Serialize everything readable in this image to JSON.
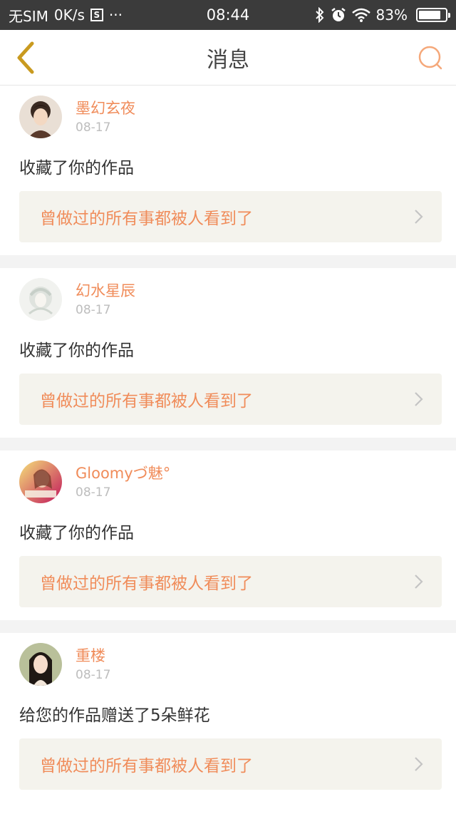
{
  "status_bar": {
    "carrier": "无SIM",
    "speed": "0K/s",
    "sim_glyph": "S",
    "more": "···",
    "time": "08:44",
    "battery_text": "83%",
    "battery_level": 0.83
  },
  "header": {
    "title": "消息"
  },
  "messages": [
    {
      "user": "墨幻玄夜",
      "date": "08-17",
      "action": "收藏了你的作品",
      "work": "曾做过的所有事都被人看到了"
    },
    {
      "user": "幻水星辰",
      "date": "08-17",
      "action": "收藏了你的作品",
      "work": "曾做过的所有事都被人看到了"
    },
    {
      "user": "Gloomyづ魅°",
      "date": "08-17",
      "action": "收藏了你的作品",
      "work": "曾做过的所有事都被人看到了"
    },
    {
      "user": "重楼",
      "date": "08-17",
      "action": "给您的作品赠送了5朵鲜花",
      "work": "曾做过的所有事都被人看到了"
    }
  ],
  "colors": {
    "accent": "#f08c5a",
    "status_bg": "#3b3b3b",
    "back_icon": "#c99a1f",
    "search_icon": "#f5a87a"
  },
  "icons": [
    "back-arrow-icon",
    "search-icon",
    "chevron-right-icon",
    "bluetooth-icon",
    "alarm-icon",
    "wifi-icon",
    "battery-icon"
  ]
}
